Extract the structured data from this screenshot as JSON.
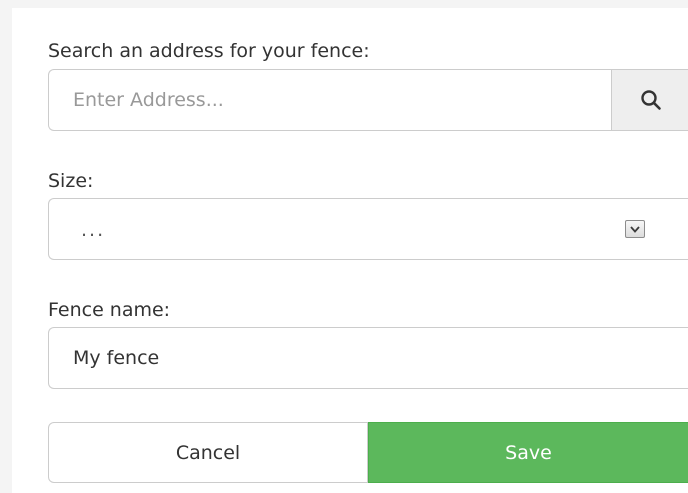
{
  "search": {
    "label": "Search an address for your fence:",
    "placeholder": "Enter Address...",
    "value": "",
    "button_icon": "search-icon"
  },
  "size": {
    "label": "Size:",
    "selected": "..."
  },
  "fence_name": {
    "label": "Fence name:",
    "value": "My fence"
  },
  "actions": {
    "cancel_label": "Cancel",
    "save_label": "Save"
  },
  "colors": {
    "save_button": "#5cb85c",
    "search_button_bg": "#eeeeee",
    "border": "#cccccc"
  }
}
